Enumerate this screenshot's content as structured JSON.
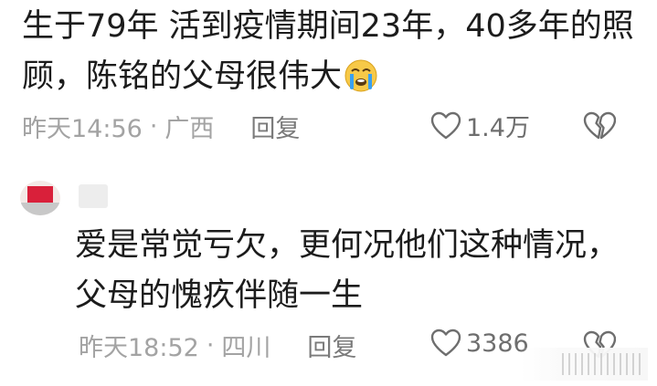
{
  "comments": [
    {
      "text_lines": [
        "生于79年  活到疫情期间23年，40多年的照",
        "顾，陈铭的父母很伟大"
      ],
      "emoji": "crying-face",
      "time": "昨天14:56",
      "separator": "·",
      "location": "广西",
      "reply_label": "回复",
      "likes": "1.4万"
    },
    {
      "text_lines": [
        "爱是常觉亏欠，更何况他们这种情况，",
        "父母的愧疚伴随一生"
      ],
      "time": "昨天18:52",
      "separator": "·",
      "location": "四川",
      "reply_label": "回复",
      "likes": "3386"
    }
  ],
  "colors": {
    "text": "#1c1c1c",
    "meta": "#a3a3a3",
    "icon": "#6e6e6e",
    "avatar_accent": "#d9203a",
    "emoji_face": "#f7c948",
    "emoji_tears": "#3aa0f0"
  }
}
